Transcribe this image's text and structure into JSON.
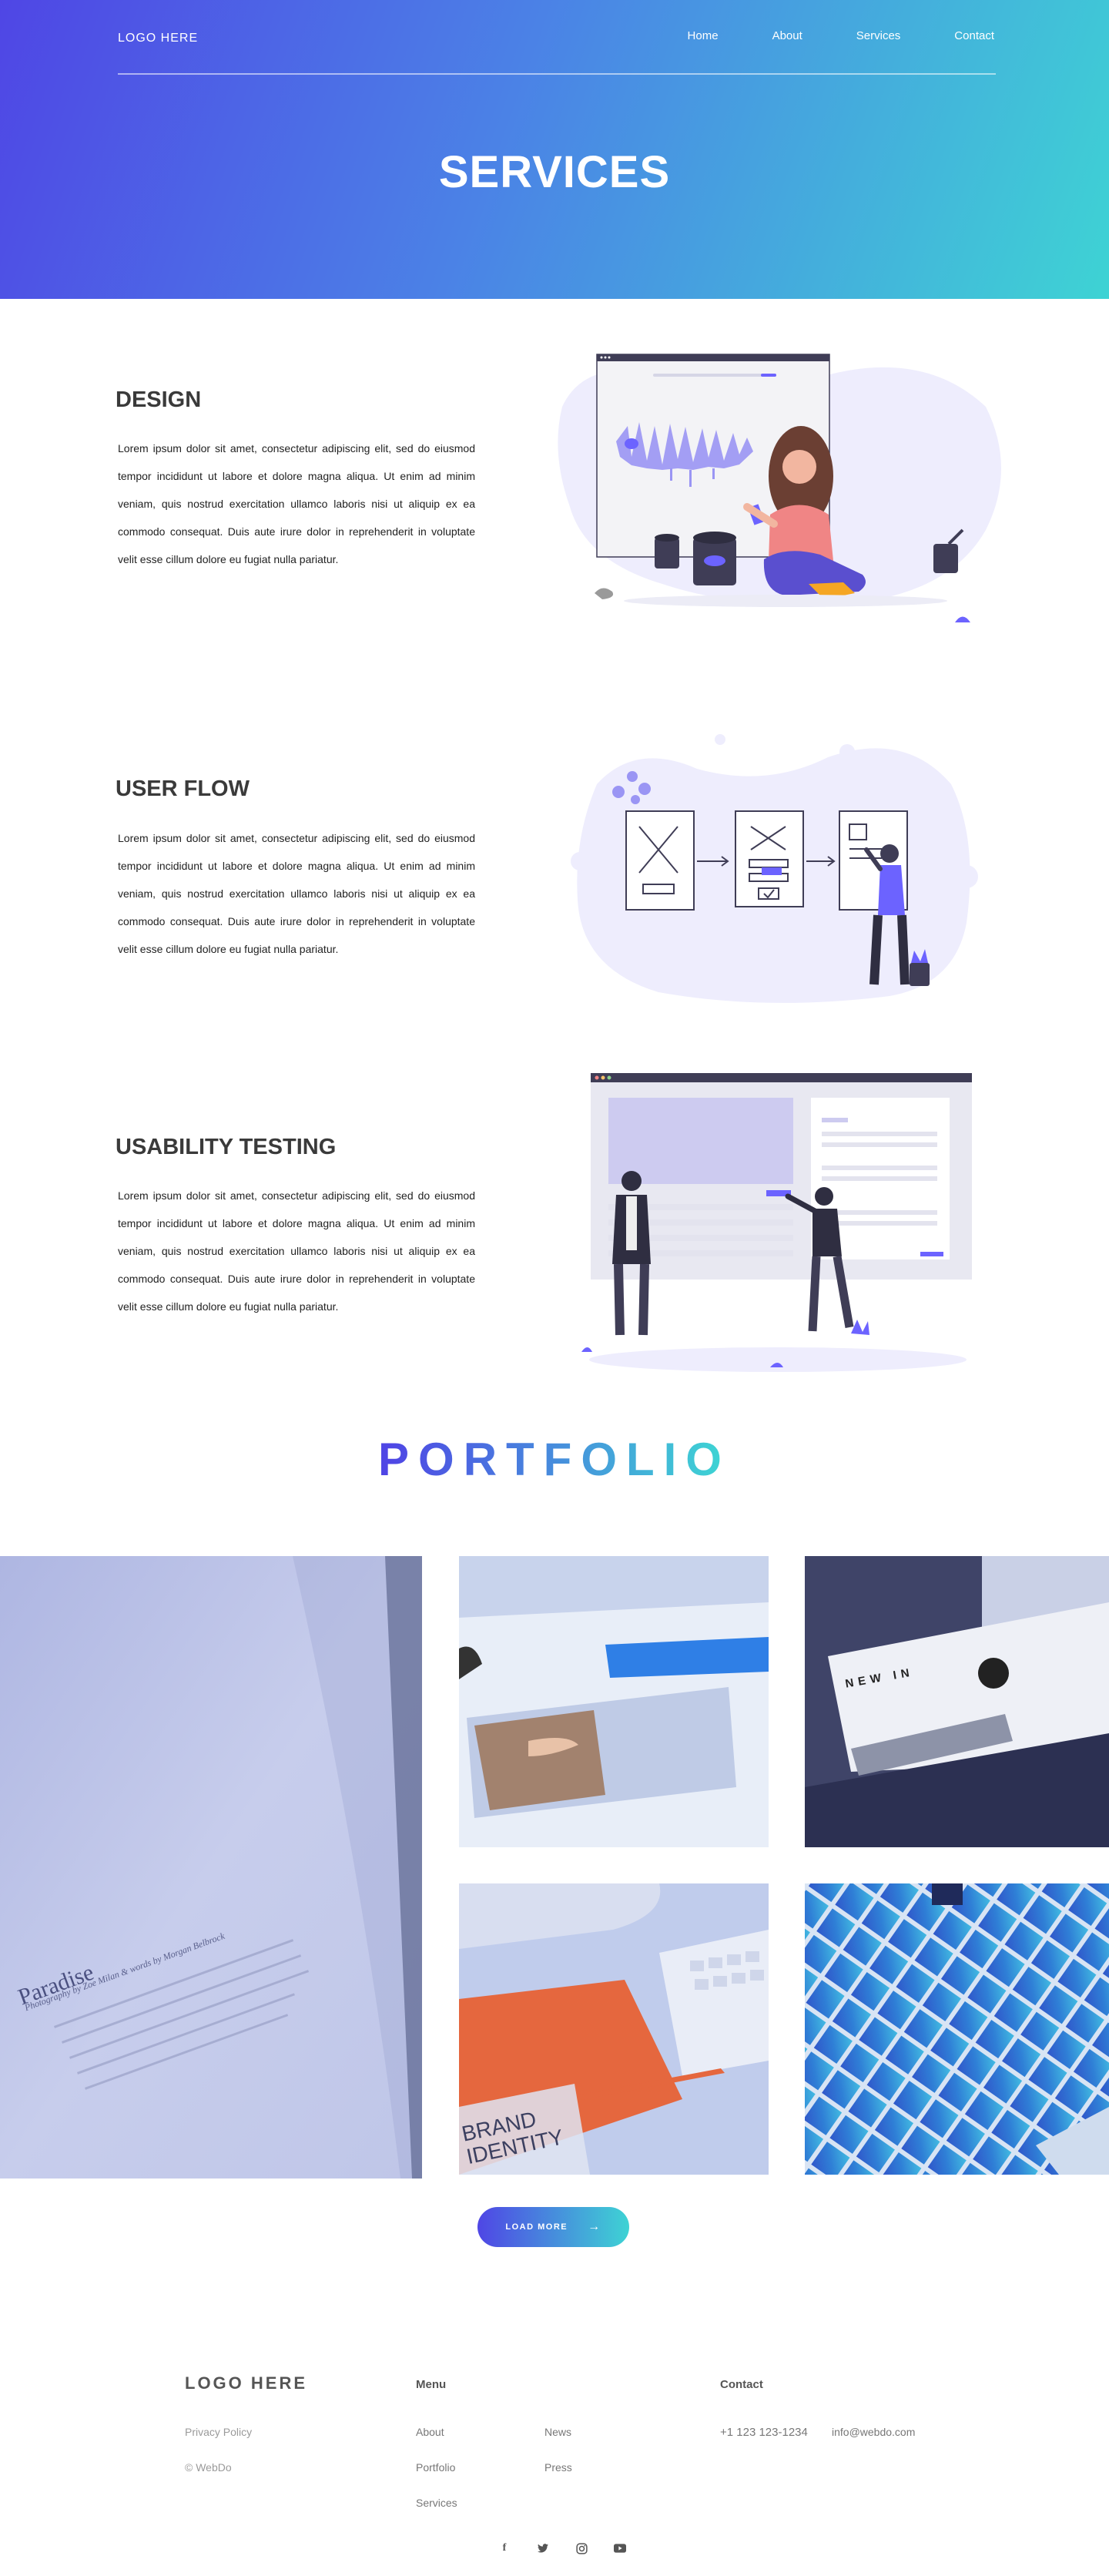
{
  "header": {
    "logo": "LOGO HERE",
    "nav": [
      "Home",
      "About",
      "Services",
      "Contact"
    ],
    "title": "SERVICES"
  },
  "services": [
    {
      "title": "DESIGN",
      "text": "Lorem ipsum dolor sit amet, consectetur adipiscing elit, sed do eiusmod tempor incididunt ut labore et dolore magna aliqua. Ut enim ad minim veniam, quis nostrud exercitation ullamco laboris nisi ut aliquip ex ea commodo consequat. Duis aute irure dolor in reprehenderit in voluptate velit esse cillum dolore eu fugiat nulla pariatur."
    },
    {
      "title": "USER FLOW",
      "text": "Lorem ipsum dolor sit amet, consectetur adipiscing elit, sed do eiusmod tempor incididunt ut labore et dolore magna aliqua. Ut enim ad minim veniam, quis nostrud exercitation ullamco laboris nisi ut aliquip ex ea commodo consequat. Duis aute irure dolor in reprehenderit in voluptate velit esse cillum dolore eu fugiat nulla pariatur."
    },
    {
      "title": "USABILITY TESTING",
      "text": "Lorem ipsum dolor sit amet, consectetur adipiscing elit, sed do eiusmod tempor incididunt ut labore et dolore magna aliqua. Ut enim ad minim veniam, quis nostrud exercitation ullamco laboris nisi ut aliquip ex ea commodo consequat. Duis aute irure dolor in reprehenderit in voluptate velit esse cillum dolore eu fugiat nulla pariatur."
    }
  ],
  "portfolio": {
    "title": "PORTFOLIO",
    "tiles": [
      {
        "name": "paradise-book",
        "overlay": "Paradise",
        "subtitle": "Photography by Zoe Milan & words by Morgan Belbrock"
      },
      {
        "name": "artwork-print"
      },
      {
        "name": "new-in-magazine",
        "overlay": "NEW IN"
      },
      {
        "name": "brand-identity-book",
        "overlay": "BRAND IDENTITY"
      },
      {
        "name": "color-swatches"
      }
    ],
    "load_more": "LOAD MORE"
  },
  "footer": {
    "logo": "LOGO HERE",
    "privacy": "Privacy Policy",
    "copyright": "© WebDo",
    "menu_heading": "Menu",
    "menu": [
      "About",
      "Portfolio",
      "Services",
      "News",
      "Press"
    ],
    "contact_heading": "Contact",
    "phone": "+1 123 123-1234",
    "email": "info@webdo.com",
    "social_icons": [
      "facebook-icon",
      "twitter-icon",
      "instagram-icon",
      "youtube-icon"
    ]
  },
  "colors": {
    "gradient_start": "#4f46e5",
    "gradient_end": "#3ed3d4",
    "illustration_accent": "#6c63ff",
    "illustration_blob": "#eeedfd"
  }
}
